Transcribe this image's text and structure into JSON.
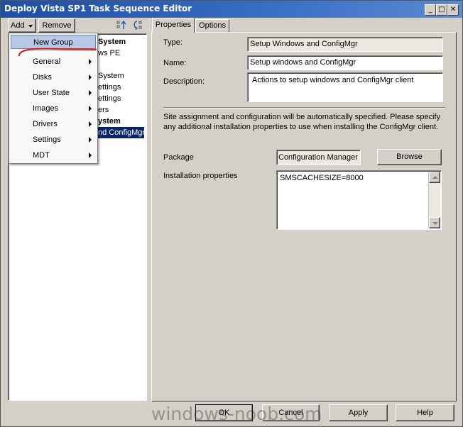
{
  "window": {
    "title": "Deploy Vista SP1 Task Sequence Editor"
  },
  "toolbar": {
    "add_label": "Add",
    "remove_label": "Remove"
  },
  "tree": {
    "items": [
      {
        "text": "System",
        "bold": true
      },
      {
        "text": "ws PE",
        "bold": false
      },
      {
        "text": "System",
        "bold": false
      },
      {
        "text": "ettings",
        "bold": false
      },
      {
        "text": "ettings",
        "bold": false
      },
      {
        "text": "ers",
        "bold": false
      },
      {
        "text": "ystem",
        "bold": true
      },
      {
        "text": "nd ConfigMgr",
        "bold": false,
        "selected": true
      }
    ]
  },
  "menu": {
    "items": [
      {
        "label": "New Group",
        "submenu": false,
        "highlighted": true
      },
      {
        "label": "General",
        "submenu": true
      },
      {
        "label": "Disks",
        "submenu": true
      },
      {
        "label": "User State",
        "submenu": true
      },
      {
        "label": "Images",
        "submenu": true
      },
      {
        "label": "Drivers",
        "submenu": true
      },
      {
        "label": "Settings",
        "submenu": true
      },
      {
        "label": "MDT",
        "submenu": true
      }
    ]
  },
  "tabs": {
    "properties": "Properties",
    "options": "Options"
  },
  "form": {
    "type_label": "Type:",
    "type_value": "Setup Windows and ConfigMgr",
    "name_label": "Name:",
    "name_value": "Setup windows and ConfigMgr",
    "description_label": "Description:",
    "description_value": "Actions to setup windows and ConfigMgr client",
    "info_text": "Site assignment and configuration will be automatically specified. Please specify any additional installation properties to use when installing the ConfigMgr client.",
    "package_label": "Package",
    "package_value": "Configuration Manager C",
    "browse_label": "Browse",
    "install_props_label": "Installation properties",
    "install_props_value": "SMSCACHESIZE=8000"
  },
  "footer": {
    "ok": "OK",
    "cancel": "Cancel",
    "apply": "Apply",
    "help": "Help"
  },
  "watermark": "windows-noob.com"
}
